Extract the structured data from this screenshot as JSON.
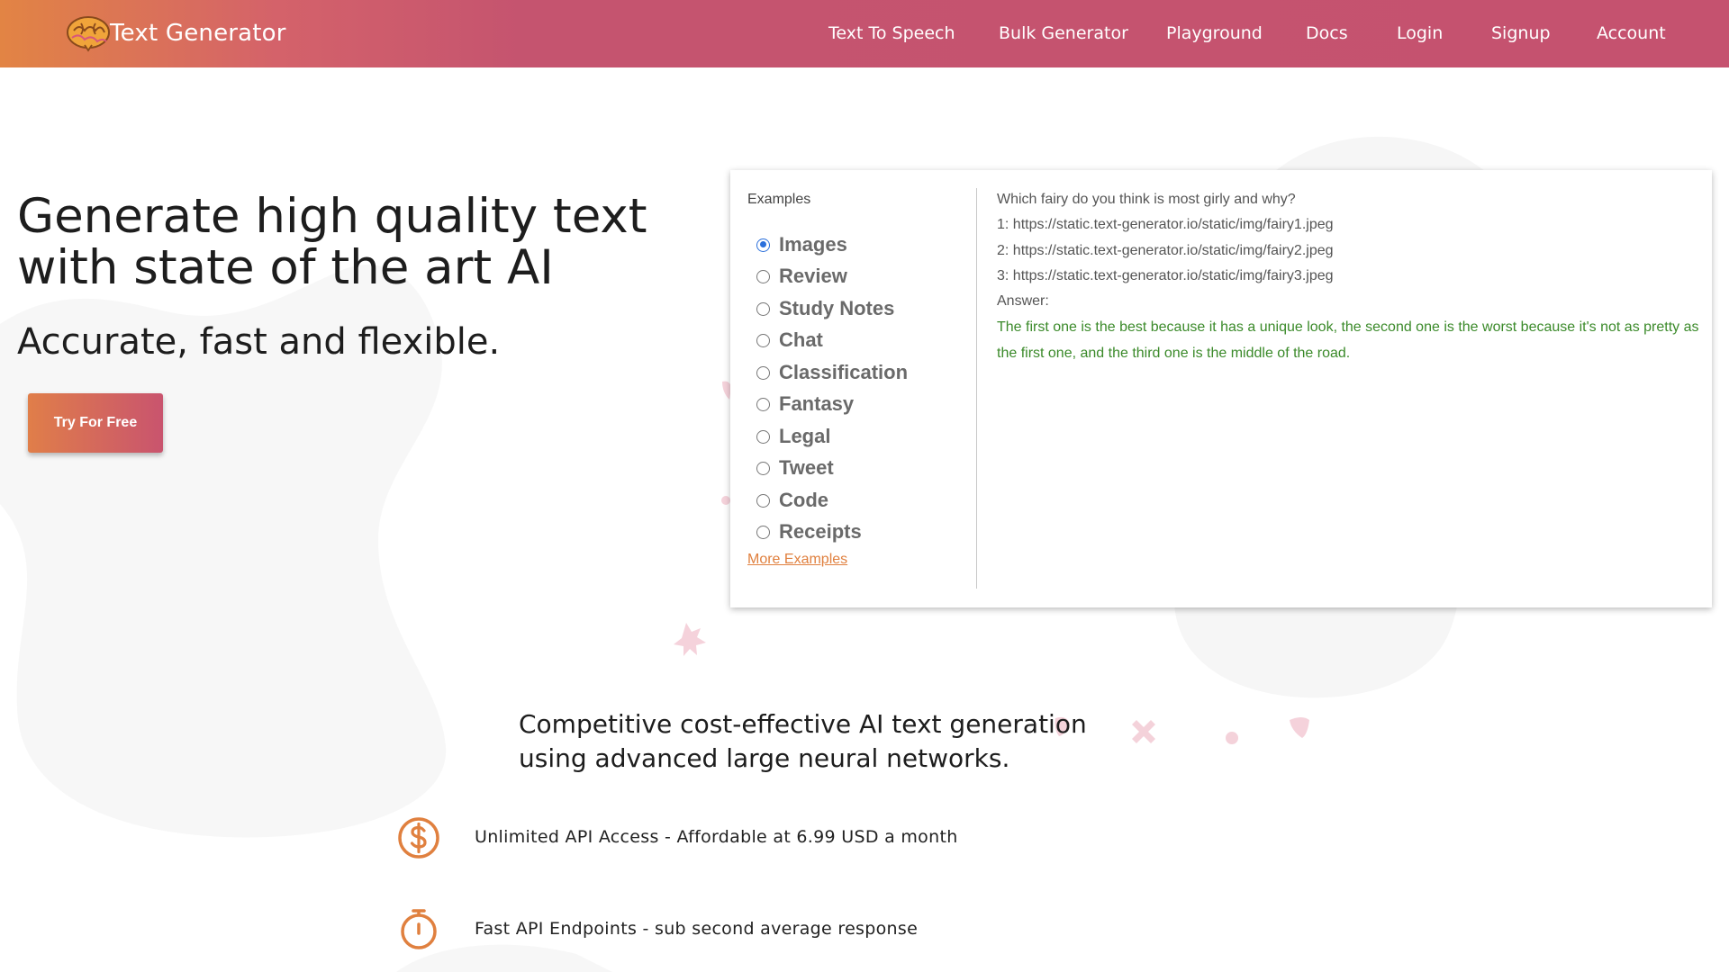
{
  "header": {
    "brand_name": "Text Generator",
    "logo_icon": "brain-icon",
    "nav_items": [
      {
        "label": "Text To Speech"
      },
      {
        "label": "Bulk Generator"
      },
      {
        "label": "Playground"
      },
      {
        "label": "Docs"
      },
      {
        "label": "Login"
      },
      {
        "label": "Signup"
      },
      {
        "label": "Account"
      }
    ]
  },
  "hero": {
    "title_line1": "Generate high quality text",
    "title_line2": "with state of the art AI",
    "subtitle": "Accurate, fast and flexible.",
    "cta_label": "Try For Free"
  },
  "examples": {
    "title": "Examples",
    "selected": "Images",
    "options": [
      {
        "label": "Images",
        "checked": true
      },
      {
        "label": "Review",
        "checked": false
      },
      {
        "label": "Study Notes",
        "checked": false
      },
      {
        "label": "Chat",
        "checked": false
      },
      {
        "label": "Classification",
        "checked": false
      },
      {
        "label": "Fantasy",
        "checked": false
      },
      {
        "label": "Legal",
        "checked": false
      },
      {
        "label": "Tweet",
        "checked": false
      },
      {
        "label": "Code",
        "checked": false
      },
      {
        "label": "Receipts",
        "checked": false
      }
    ],
    "more_label": "More Examples",
    "prompt_lines": [
      "Which fairy do you think is most girly and why?",
      "1: https://static.text-generator.io/static/img/fairy1.jpeg",
      "2: https://static.text-generator.io/static/img/fairy2.jpeg",
      "3: https://static.text-generator.io/static/img/fairy3.jpeg",
      "Answer:"
    ],
    "answer": "The first one is the best because it has a unique look, the second one is the worst because it's not as pretty as the first one, and the third one is the middle of the road."
  },
  "features": {
    "heading": "Competitive cost-effective AI text generation using advanced large neural networks.",
    "items": [
      {
        "icon": "dollar-circle-icon",
        "text": "Unlimited API Access - Affordable at 6.99 USD a month"
      },
      {
        "icon": "stopwatch-icon",
        "text": "Fast API Endpoints - sub second average response"
      }
    ]
  },
  "colors": {
    "header_gradient_start": "#e28444",
    "header_gradient_end": "#c5526f",
    "accent_orange": "#e0803f",
    "answer_green": "#3b8a2a",
    "radio_blue": "#2a6fdb"
  }
}
